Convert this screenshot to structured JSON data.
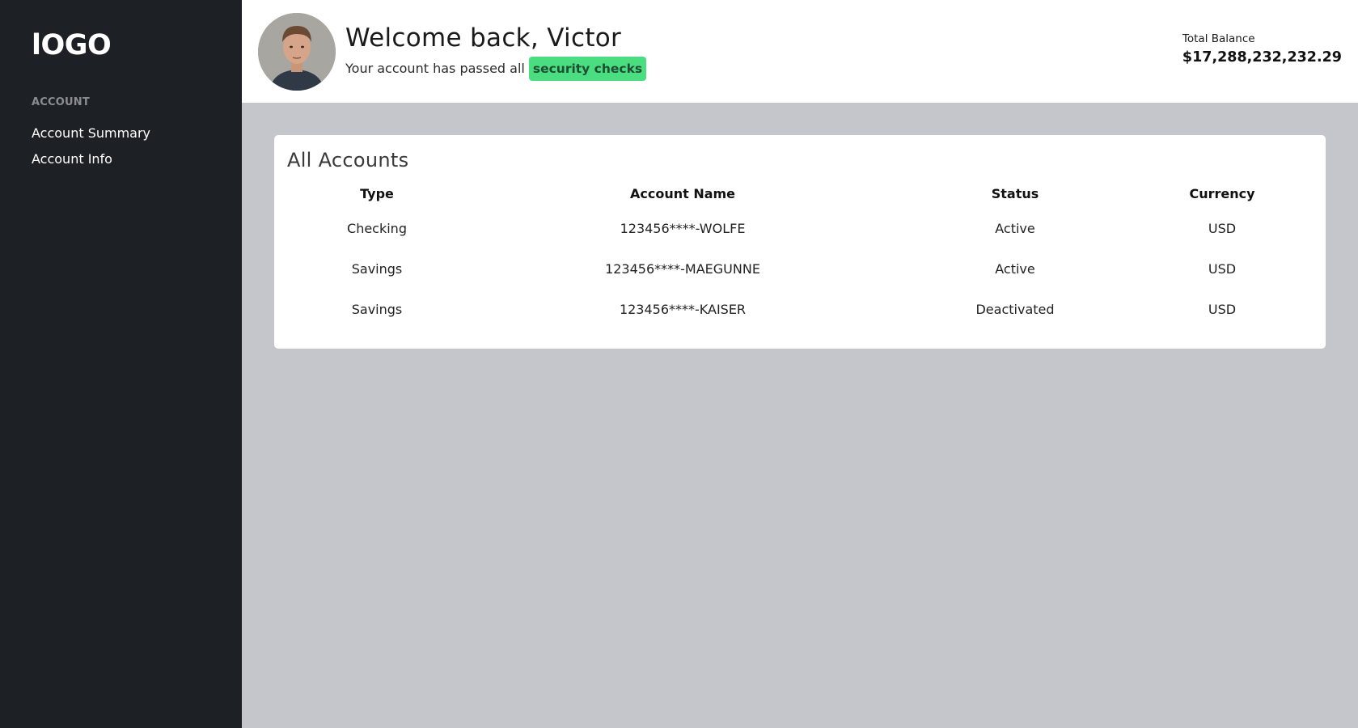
{
  "sidebar": {
    "logo": "lOGO",
    "section_label": "ACCOUNT",
    "items": [
      {
        "label": "Account Summary"
      },
      {
        "label": "Account Info"
      }
    ]
  },
  "header": {
    "welcome": "Welcome back, Victor",
    "subtitle_prefix": "Your account has passed all",
    "badge": "security checks",
    "balance_label": "Total Balance",
    "balance_value": "$17,288,232,232.29"
  },
  "accounts": {
    "title": "All Accounts",
    "columns": [
      "Type",
      "Account Name",
      "Status",
      "Currency"
    ],
    "rows": [
      [
        "Checking",
        "123456****-WOLFE",
        "Active",
        "USD"
      ],
      [
        "Savings",
        "123456****-MAEGUNNE",
        "Active",
        "USD"
      ],
      [
        "Savings",
        "123456****-KAISER",
        "Deactivated",
        "USD"
      ]
    ]
  },
  "colors": {
    "sidebar_bg": "#1d2025",
    "page_bg": "#c4c6cb",
    "badge_bg": "#4ade80",
    "badge_text": "#1e4d33"
  }
}
